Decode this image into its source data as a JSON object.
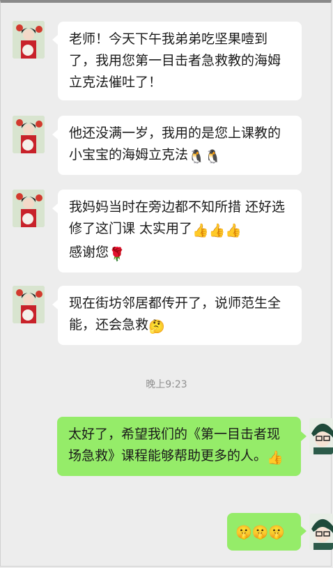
{
  "messages": [
    {
      "text": "⁠老师！今天下午我弟弟吃坚果噎到了，我用您第一目击者急救教的海姆立克法催吐了！",
      "emoji": ""
    },
    {
      "text": "他还没满一岁，我用的是您上课教的小宝宝的海姆立克法",
      "emoji": "🐧🐧"
    },
    {
      "text": "我妈妈当时在旁边都不知所措 还好选修了这门课 太实用了",
      "emoji": "👍👍👍",
      "tail_text": "感谢您",
      "tail_emoji": "🌹"
    },
    {
      "text": "现在街坊邻居都传开了，说师范生全能，还会急救",
      "emoji": "🤔"
    }
  ],
  "timestamp": "晚上9:23",
  "self_messages": [
    {
      "text": "太好了，希望我们的《第一目击者现场急救》课程能够帮助更多的人。",
      "emoji": "👍"
    },
    {
      "text": "",
      "emoji": "🤫🤫🤫"
    }
  ],
  "colors": {
    "self_bubble": "#95ec69",
    "other_bubble": "#ffffff",
    "background": "#ededed"
  }
}
